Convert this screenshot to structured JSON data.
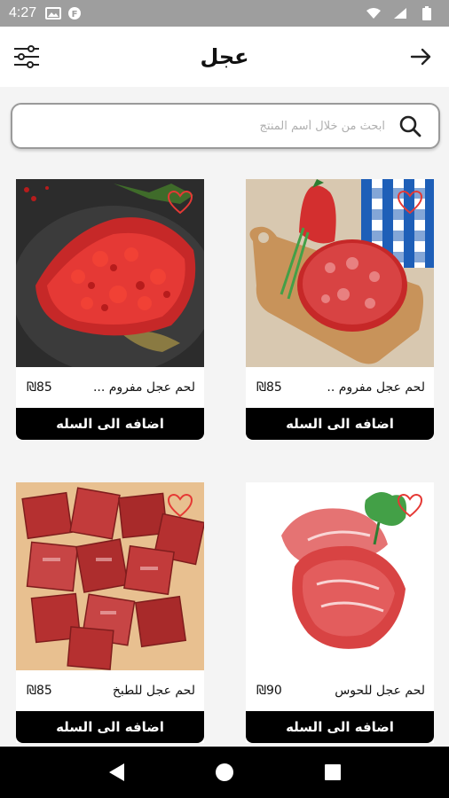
{
  "status_bar": {
    "time": "4:27"
  },
  "app_bar": {
    "title": "عجل"
  },
  "search": {
    "placeholder": "ابحث من خلال أسم المنتج"
  },
  "products": [
    {
      "name": "لحم عجل مفروم ...",
      "price": "₪85",
      "button": "اضافه الى السله",
      "favorite": false
    },
    {
      "name": "لحم عجل مفروم ..",
      "price": "₪85",
      "button": "اضافه الى السله",
      "favorite": false
    },
    {
      "name": "لحم عجل للحوس",
      "price": "₪90",
      "button": "اضافه الى السله",
      "favorite": false
    },
    {
      "name": "لحم عجل للطبخ",
      "price": "₪85",
      "button": "اضافه الى السله",
      "favorite": false
    }
  ],
  "colors": {
    "heart": "#e53935",
    "button_bg": "#000000",
    "status_bar": "#9e9e9e"
  },
  "icons": {
    "status": [
      "gallery-icon",
      "app-icon",
      "wifi-icon",
      "signal-icon",
      "battery-icon"
    ],
    "nav": [
      "back-triangle-icon",
      "home-circle-icon",
      "recents-square-icon"
    ]
  }
}
